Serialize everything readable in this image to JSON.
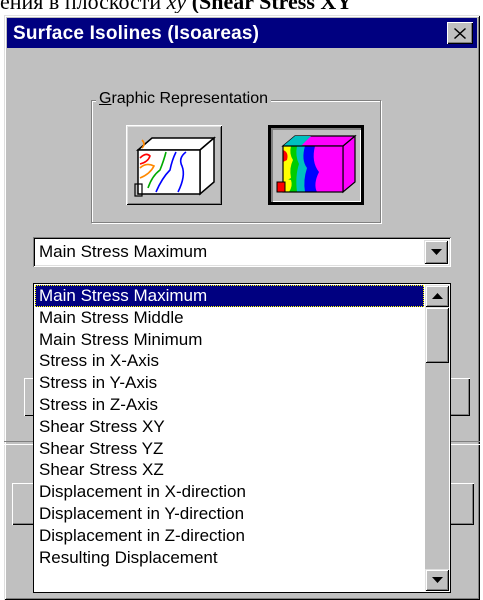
{
  "document": {
    "text_normal": "ения в плоскости ",
    "text_italic": "xy",
    "text_bold": " (Shear Stress XY"
  },
  "dialog": {
    "title": "Surface Isolines (Isoareas)",
    "close_icon": "close-icon"
  },
  "graphic_representation": {
    "label_mnemonic": "G",
    "label_rest": "raphic Representation",
    "options": [
      {
        "name": "isolines",
        "icon": "isolines-box-icon",
        "pressed": false
      },
      {
        "name": "isoareas",
        "icon": "isoareas-box-icon",
        "pressed": true
      }
    ]
  },
  "result_combo": {
    "selected": "Main Stress Maximum",
    "arrow_icon": "dropdown-arrow-icon"
  },
  "dropdown_options": [
    "Main Stress Maximum",
    "Main Stress Middle",
    "Main Stress Minimum",
    "Stress in X-Axis",
    "Stress in Y-Axis",
    "Stress in Z-Axis",
    "Shear Stress XY",
    "Shear Stress YZ",
    "Shear Stress XZ",
    "Displacement in X-direction",
    "Displacement in Y-direction",
    "Displacement in Z-direction",
    "Resulting Displacement"
  ],
  "colors": {
    "titlebar": "#000080",
    "face": "#c0c0c0",
    "selection": "#000080"
  }
}
